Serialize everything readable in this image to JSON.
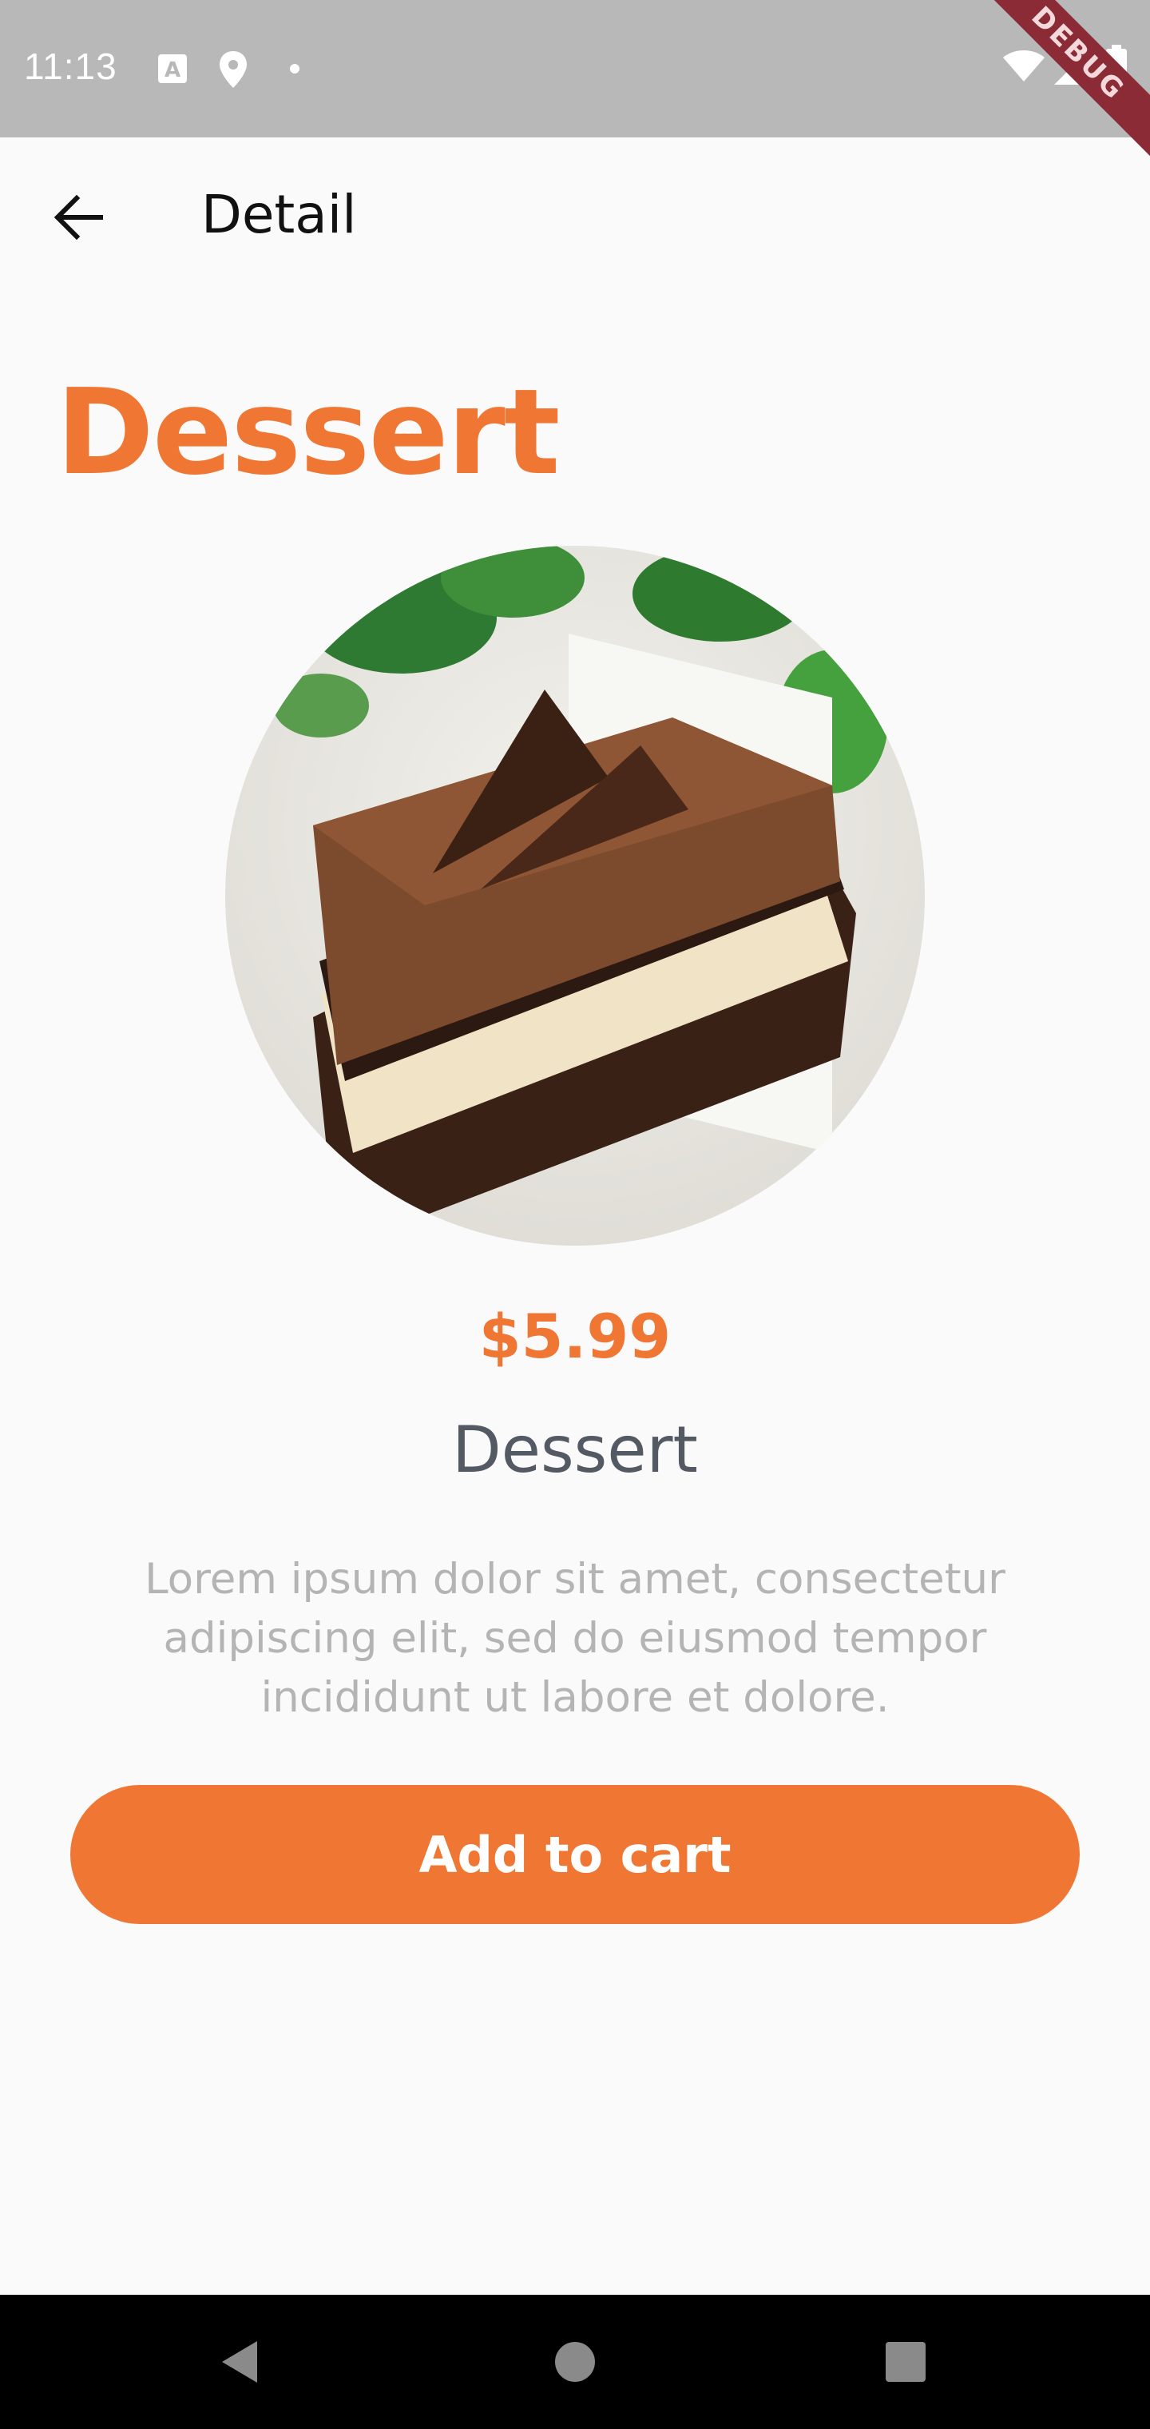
{
  "status_bar": {
    "time": "11:13",
    "debug_label": "DEBUG"
  },
  "app_bar": {
    "title": "Detail",
    "back_icon": "arrow-back-icon"
  },
  "product": {
    "heading": "Dessert",
    "price": "$5.99",
    "name": "Dessert",
    "description": "Lorem ipsum dolor sit amet, consectetur adipiscing elit, sed do eiusmod tempor incididunt ut labore et dolore."
  },
  "actions": {
    "add_to_cart": "Add to cart"
  },
  "colors": {
    "accent": "#f07634",
    "name_text": "#545a64",
    "description_text": "#b4b4b4",
    "background": "#fafafa"
  },
  "nav_bar": {
    "back_icon": "nav-back-icon",
    "home_icon": "nav-home-icon",
    "recents_icon": "nav-recents-icon"
  }
}
